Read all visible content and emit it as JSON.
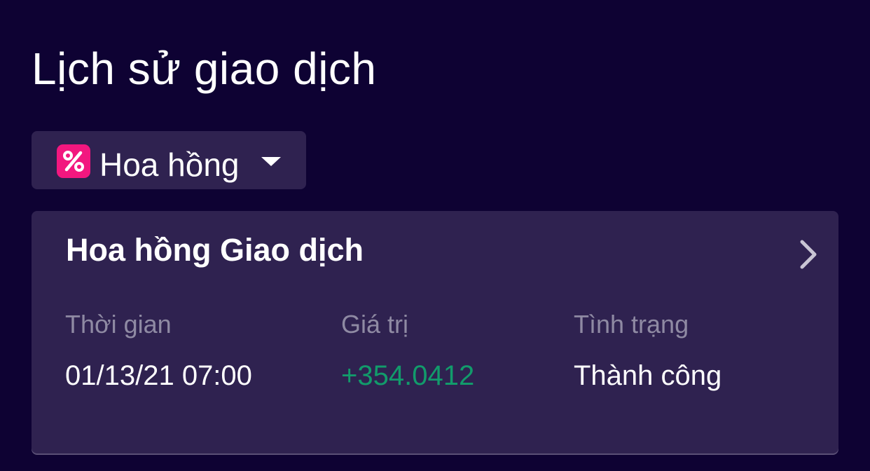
{
  "header": {
    "title": "Lịch sử giao dịch"
  },
  "filter": {
    "icon": "percent-icon",
    "selected_label": "Hoa hồng",
    "caret_icon": "caret-down-icon",
    "icon_color": "#f2177f"
  },
  "transaction": {
    "title": "Hoa hồng Giao dịch",
    "chevron_icon": "chevron-right-icon",
    "columns": {
      "time_label": "Thời gian",
      "value_label": "Giá trị",
      "status_label": "Tình trạng"
    },
    "time": "01/13/21 07:00",
    "value": "+354.0412",
    "status": "Thành công",
    "value_color": "#129b6b"
  },
  "theme": {
    "background": "#0e0233",
    "card_background": "#2f2250",
    "muted_text": "#8f8aa3"
  }
}
